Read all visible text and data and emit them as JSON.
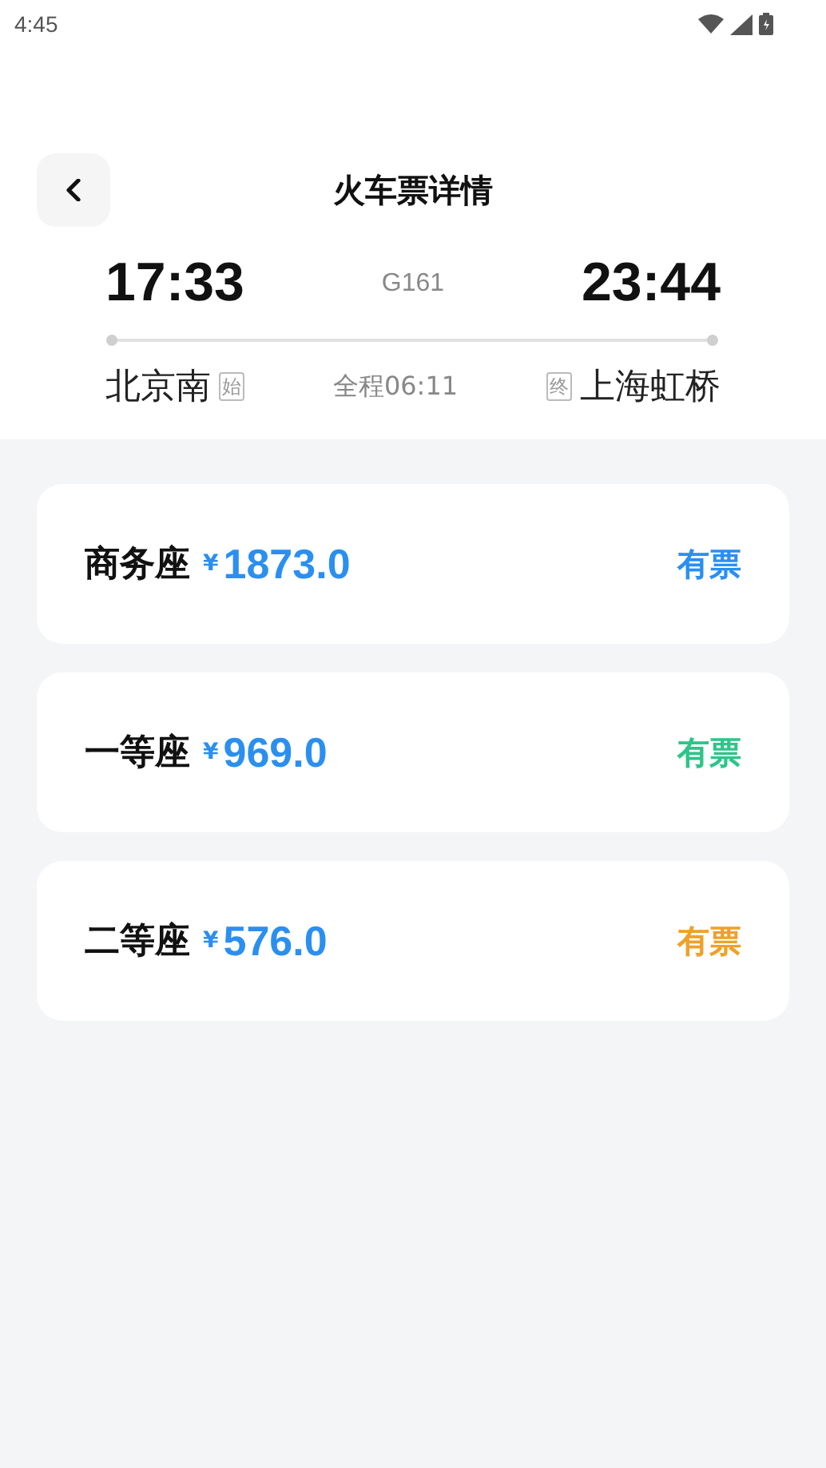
{
  "status_bar": {
    "time": "4:45"
  },
  "header": {
    "title": "火车票详情"
  },
  "trip": {
    "depart_time": "17:33",
    "train_no": "G161",
    "arrive_time": "23:44",
    "from_station": "北京南",
    "from_tag": "始",
    "duration": "全程06:11",
    "to_tag": "终",
    "to_station": "上海虹桥"
  },
  "seats": [
    {
      "name": "商务座",
      "currency": "¥",
      "price": "1873.0",
      "availability": "有票",
      "color": "#2b8ff0"
    },
    {
      "name": "一等座",
      "currency": "¥",
      "price": "969.0",
      "availability": "有票",
      "color": "#2ec48a"
    },
    {
      "name": "二等座",
      "currency": "¥",
      "price": "576.0",
      "availability": "有票",
      "color": "#eea12a"
    }
  ]
}
